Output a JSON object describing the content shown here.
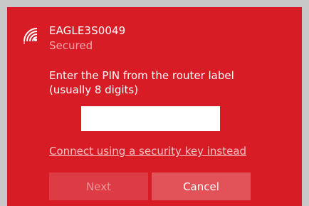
{
  "network": {
    "ssid": "EAGLE3S0049",
    "status": "Secured",
    "icon": "wifi-signal-icon"
  },
  "pin": {
    "prompt_line1": "Enter the PIN from the router label",
    "prompt_line2": "(usually 8 digits)",
    "value": ""
  },
  "links": {
    "security_key": "Connect using a security key instead"
  },
  "buttons": {
    "next": "Next",
    "cancel": "Cancel"
  },
  "colors": {
    "accent": "#d81c26",
    "backdrop": "#c8c8c8"
  }
}
